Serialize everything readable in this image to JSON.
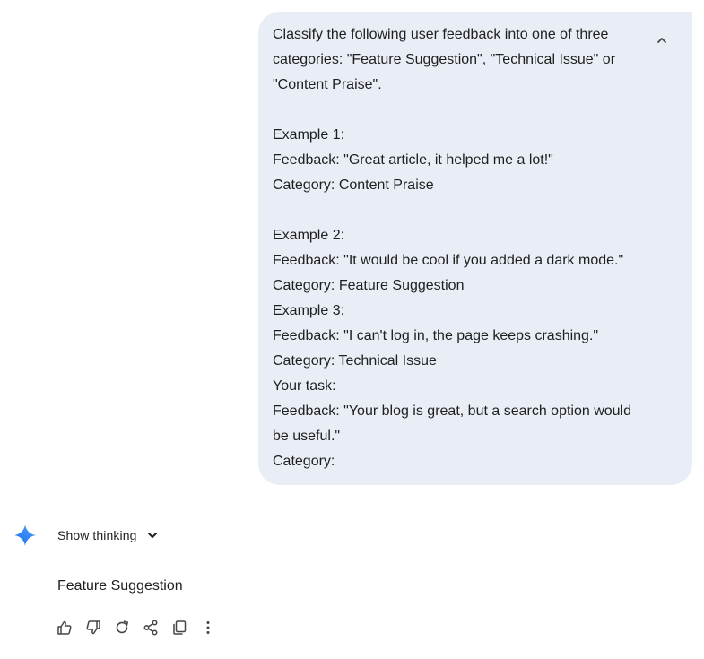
{
  "user_message": {
    "lines": [
      "Classify the following user feedback into one of three",
      "categories: \"Feature Suggestion\", \"Technical Issue\" or",
      "\"Content Praise\".",
      "",
      "Example 1:",
      "Feedback: \"Great article, it helped me a lot!\"",
      "Category: Content Praise",
      "",
      "Example 2:",
      "Feedback: \"It would be cool if you added a dark mode.\"",
      "Category: Feature Suggestion",
      "Example 3:",
      "Feedback: \"I can't log in, the page keeps crashing.\"",
      "Category: Technical Issue",
      "Your task:",
      "Feedback: \"Your blog is great, but a search option would",
      "be useful.\"",
      "Category:"
    ],
    "collapse_icon": "chevron-up-icon"
  },
  "model_response": {
    "logo_icon": "gemini-sparkle-icon",
    "show_thinking_label": "Show thinking",
    "show_thinking_icon": "chevron-down-icon",
    "text": "Feature Suggestion"
  },
  "actions": [
    {
      "name": "thumbs-up-icon"
    },
    {
      "name": "thumbs-down-icon"
    },
    {
      "name": "regenerate-icon"
    },
    {
      "name": "share-icon"
    },
    {
      "name": "copy-icon"
    },
    {
      "name": "more-options-icon"
    }
  ],
  "colors": {
    "bubble_bg": "#e9eef6",
    "text": "#1f1f1f",
    "icon": "#444746",
    "accent_blue": "#4285f4"
  }
}
